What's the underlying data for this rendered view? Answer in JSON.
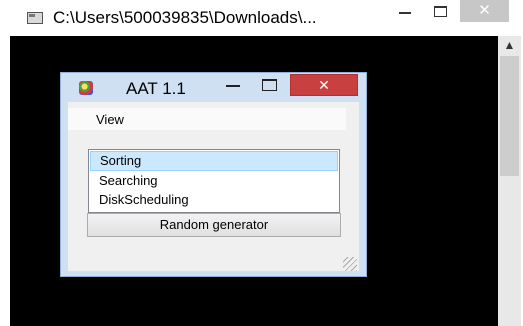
{
  "console_window": {
    "title": "C:\\Users\\500039835\\Downloads\\...",
    "minimize_label": "−",
    "maximize_label": "☐",
    "close_label": "✕",
    "scroll_up_label": "▲"
  },
  "aat_window": {
    "title": "AAT 1.1",
    "close_label": "✕",
    "menu": {
      "view_label": "View"
    },
    "list_items": [
      "Sorting",
      "Searching",
      "DiskScheduling"
    ],
    "selected_index": 0,
    "random_button_label": "Random generator"
  }
}
